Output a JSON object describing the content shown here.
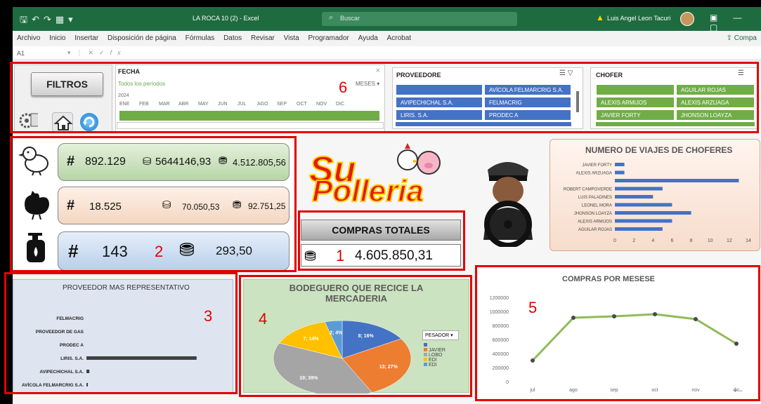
{
  "window": {
    "title": "LA ROCA 10 (2)  -  Excel",
    "search_placeholder": "Buscar",
    "user": "Luis Angel Leon Tacuri"
  },
  "menu": {
    "items": [
      "Archivo",
      "Inicio",
      "Insertar",
      "Disposición de página",
      "Fórmulas",
      "Datos",
      "Revisar",
      "Vista",
      "Programador",
      "Ayuda",
      "Acrobat"
    ],
    "share": "Compa"
  },
  "formula_bar": {
    "cell_ref": "A1",
    "fx": "fx"
  },
  "filters": {
    "button": "FILTROS",
    "fecha": {
      "title": "FECHA",
      "all_periods": "Todos los períodos",
      "level": "MESES",
      "year": "2024",
      "months": [
        "ENE",
        "FEB",
        "MAR",
        "ABR",
        "MAY",
        "JUN",
        "JUL",
        "AGO",
        "SEP",
        "OCT",
        "NOV",
        "DIC"
      ]
    },
    "proveedor": {
      "title": "PROVEEDORE",
      "items": [
        "",
        "AVÍCOLA FELMARCRIG S.A.",
        "AVIPECHICHAL S.A.",
        "FELMACRIG",
        "LIRIS. S.A.",
        "PRODEC A"
      ]
    },
    "chofer": {
      "title": "CHOFER",
      "items": [
        "",
        "AGUILAR ROJAS",
        "ALEXIS ARMIJOS",
        "ALEXIS ARZUAGA",
        "JAVIER FORTY",
        "JHONSON LOAYZA"
      ]
    }
  },
  "kpis": {
    "pollo": {
      "hash": "#",
      "count": "892.129",
      "weight": "5644146,93",
      "money": "4.512.805,56"
    },
    "gallina": {
      "hash": "#",
      "count": "18.525",
      "weight": "70.050,53",
      "money": "92.751,25"
    },
    "gas": {
      "hash": "#",
      "count": "143",
      "money": "293,50"
    },
    "weight_icon_label": "LB"
  },
  "compras_totales": {
    "header": "COMPRAS TOTALES",
    "value": "4.605.850,31"
  },
  "red_labels": {
    "n1": "1",
    "n2": "2",
    "n3": "3",
    "n4": "4",
    "n5": "5",
    "n6": "6"
  },
  "chart_data": [
    {
      "type": "bar",
      "title": "NUMERO DE VIAJES DE CHOFERES",
      "orientation": "horizontal",
      "categories": [
        "JAVIER FORTY",
        "ALEXIS ARZUAGA",
        "",
        "ROBERT CAMPOVERDE",
        "LUIS PALADINES",
        "LEONEL MORA",
        "JHONSON LOAYZA",
        "ALEXIS ARMIJOS",
        "AGUILAR ROJAS"
      ],
      "values": [
        1,
        1,
        13,
        5,
        4,
        6,
        8,
        6,
        5
      ],
      "xlim": [
        0,
        14
      ],
      "xticks": [
        0,
        2,
        4,
        6,
        8,
        10,
        12,
        14
      ],
      "color": "#4472c4"
    },
    {
      "type": "bar",
      "title": "PROVEEDOR  MAS REPRESENTATIVO",
      "orientation": "horizontal",
      "categories": [
        "FELMACRIG",
        "PROVEEDOR DE GAS",
        "PRODEC A",
        "LIRIS. S.A.",
        "AVIPECHICHAL S.A.",
        "AVÍCOLA FELMARCRIG S.A."
      ],
      "values": [
        0,
        0,
        0,
        3000000,
        80000,
        10000
      ],
      "color": "#404040"
    },
    {
      "type": "pie",
      "title": "BODEGUERO QUE RECICE LA MERCADERIA",
      "slices": [
        {
          "label": "8; 16%",
          "value": 8,
          "percent": 16,
          "color": "#4472c4"
        },
        {
          "label": "13; 27%",
          "value": 13,
          "percent": 27,
          "color": "#ed7d31"
        },
        {
          "label": "19; 39%",
          "value": 19,
          "percent": 39,
          "color": "#a5a5a5"
        },
        {
          "label": "7; 14%",
          "value": 7,
          "percent": 14,
          "color": "#ffc000"
        },
        {
          "label": "2; 4%",
          "value": 2,
          "percent": 4,
          "color": "#5b9bd5"
        }
      ],
      "legend": {
        "title": "PESADOR",
        "entries": [
          {
            "name": "",
            "color": "#4472c4"
          },
          {
            "name": "JAVIER",
            "color": "#ed7d31"
          },
          {
            "name": "LOBO",
            "color": "#a5a5a5"
          },
          {
            "name": "EDI",
            "color": "#ffc000"
          },
          {
            "name": "EDI",
            "color": "#5b9bd5"
          }
        ],
        "placement": "right"
      }
    },
    {
      "type": "line",
      "title": "COMPRAS POR MESESE",
      "categories": [
        "jul",
        "ago",
        "sep",
        "oct",
        "nov",
        "dic"
      ],
      "values": [
        300000,
        910000,
        930000,
        960000,
        890000,
        540000
      ],
      "ylim": [
        0,
        1200000
      ],
      "yticks": [
        0,
        200000,
        400000,
        600000,
        800000,
        1000000,
        1200000
      ],
      "color": "#8fbc5a"
    }
  ]
}
